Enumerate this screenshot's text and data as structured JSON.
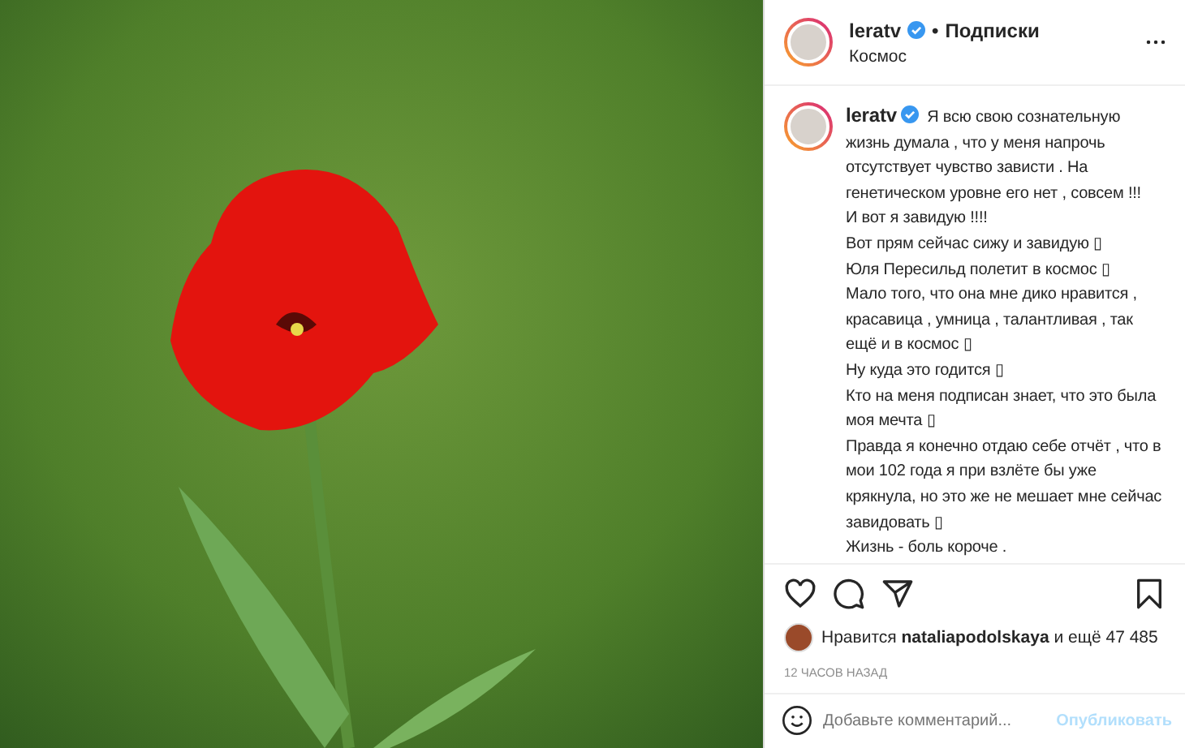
{
  "header": {
    "username": "leratv",
    "verified": true,
    "separator": "•",
    "follow": "Подписки",
    "location": "Космос"
  },
  "caption": {
    "username": "leratv",
    "verified": true,
    "first": "Я всю свою сознательную жизнь думала , что у меня напрочь отсутствует чувство зависти . На генетическом уровне его нет , совсем !!!",
    "lines": [
      "И вот я завидую !!!!",
      "Вот прям сейчас сижу и завидую ▯",
      "Юля Пересильд полетит в космос ▯",
      "Мало того, что она мне дико нравится , красавица , умница , талантливая , так ещё и в космос ▯",
      "Ну куда это годится ▯",
      "Кто на меня подписан знает, что это была моя мечта ▯",
      "Правда я конечно отдаю себе отчёт , что в мои 102 года я при взлёте бы уже крякнула, но это же не мешает мне сейчас завидовать ▯",
      "Жизнь - боль короче ."
    ]
  },
  "actions": {
    "liked": false,
    "saved": false
  },
  "likes": {
    "prefix": "Нравится",
    "user": "nataliapodolskaya",
    "suffix": "и ещё 47 485"
  },
  "time": "12 ЧАСОВ НАЗАД",
  "comment": {
    "placeholder": "Добавьте комментарий...",
    "publish": "Опубликовать"
  }
}
